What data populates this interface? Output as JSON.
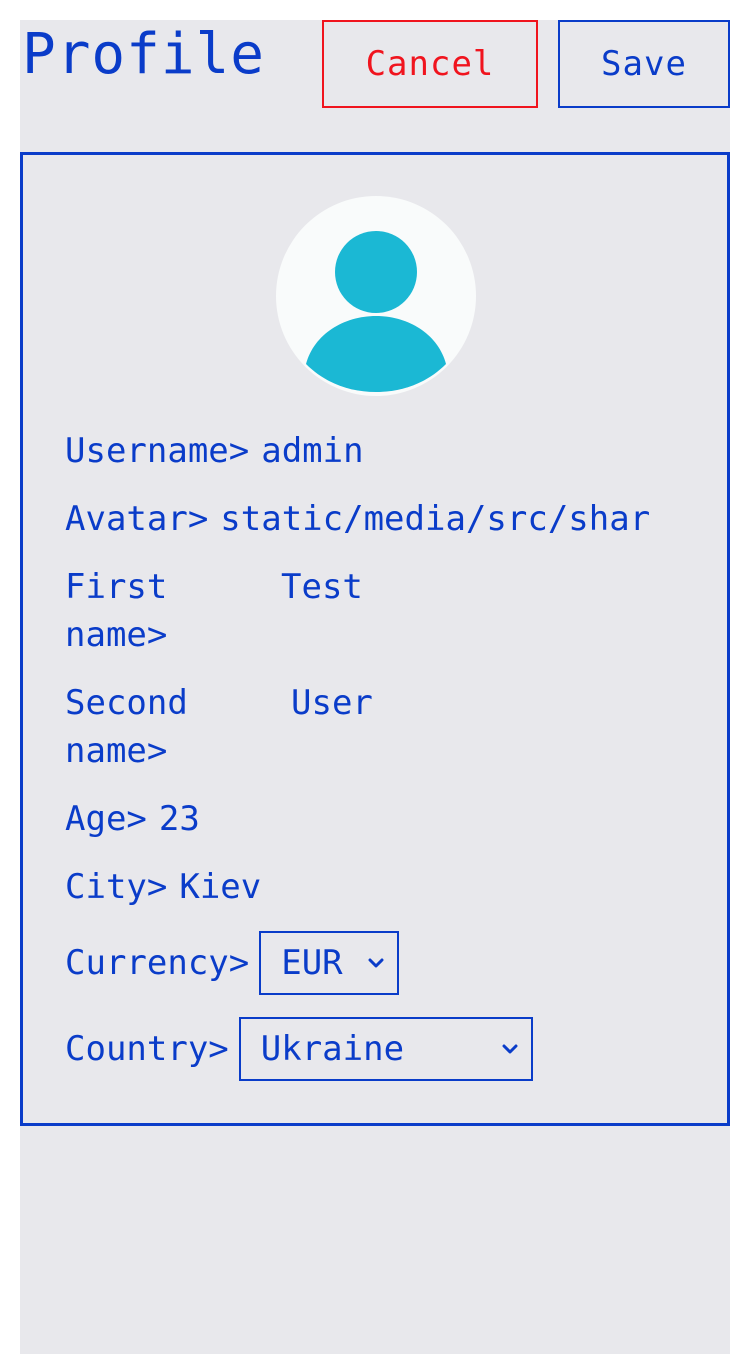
{
  "header": {
    "title": "Profile",
    "cancel_label": "Cancel",
    "save_label": "Save"
  },
  "profile": {
    "avatar_icon": "user-avatar-icon",
    "username_label": "Username>",
    "username_value": "admin",
    "avatar_label": "Avatar>",
    "avatar_value": "static/media/src/shar",
    "first_name_label": "First name>",
    "first_name_value": "Test",
    "second_name_label": "Second name>",
    "second_name_value": "User",
    "age_label": "Age>",
    "age_value": "23",
    "city_label": "City>",
    "city_value": "Kiev",
    "currency_label": "Currency>",
    "currency_value": "EUR",
    "country_label": "Country>",
    "country_value": "Ukraine"
  },
  "colors": {
    "primary": "#0a3cc9",
    "danger": "#f0141e",
    "background": "#e8e8ec",
    "avatar_bg": "#f9fbfb",
    "avatar_fg": "#1bb8d4"
  }
}
